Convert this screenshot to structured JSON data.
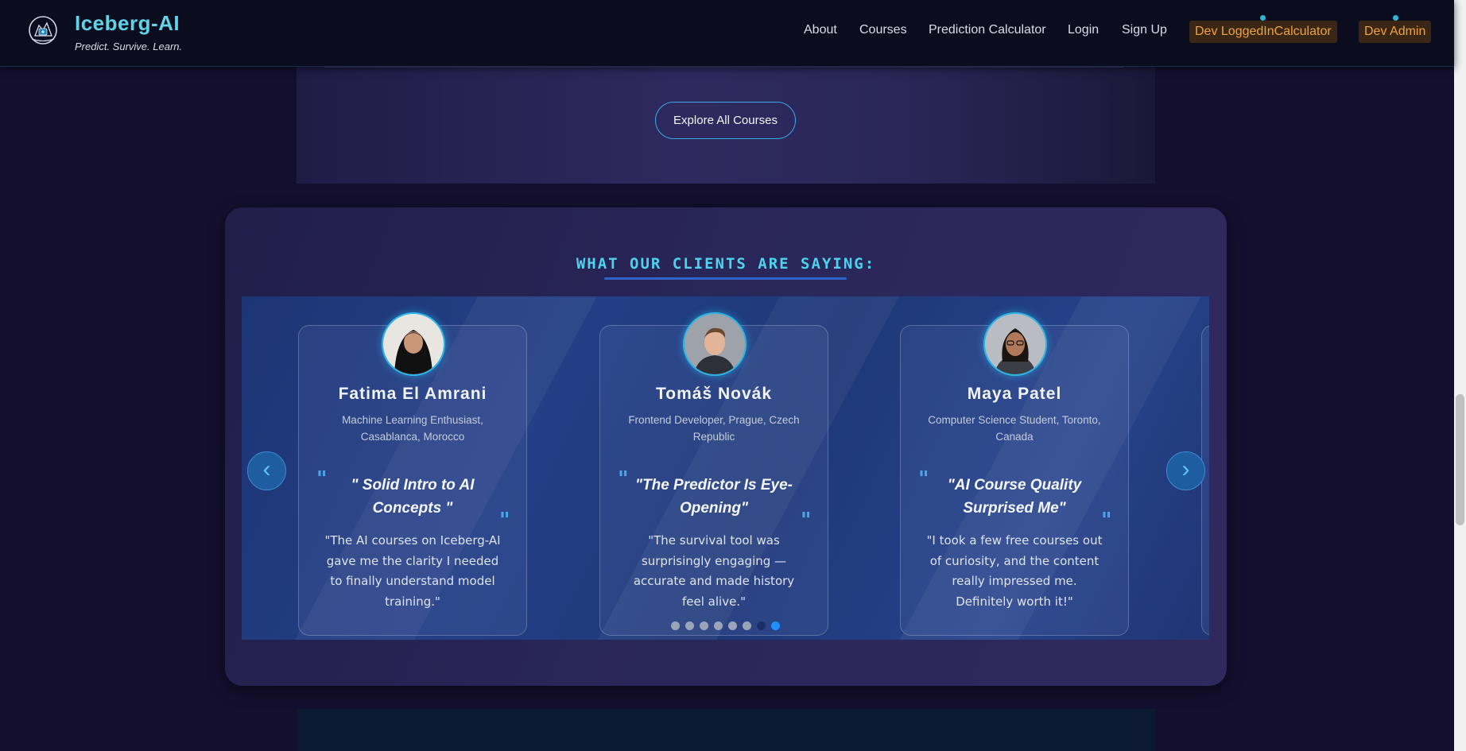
{
  "brand": {
    "title": "Iceberg-AI",
    "tagline": "Predict. Survive. Learn."
  },
  "nav": {
    "links": [
      "About",
      "Courses",
      "Prediction Calculator",
      "Login",
      "Sign Up"
    ],
    "dev_buttons": [
      "Dev LoggedInCalculator",
      "Dev Admin"
    ]
  },
  "courses": {
    "explore_label": "Explore All Courses"
  },
  "testimonials": {
    "title": "What our clients are saying:",
    "cards": [
      {
        "name": "Fatima El Amrani",
        "role": "Machine Learning Enthusiast, Casablanca, Morocco",
        "headline": "\" Solid Intro to AI Concepts \"",
        "text": "\"The AI courses on Iceberg-AI gave me the clarity I needed to finally understand model training.\""
      },
      {
        "name": "Tomáš Novák",
        "role": "Frontend Developer, Prague, Czech Republic",
        "headline": "\"The Predictor Is Eye-Opening\"",
        "text": "\"The survival tool was surprisingly engaging — accurate and made history feel alive.\""
      },
      {
        "name": "Maya Patel",
        "role": "Computer Science Student, Toronto, Canada",
        "headline": "\"AI Course Quality Surprised Me\"",
        "text": "\"I took a few free courses out of curiosity, and the content really impressed me. Definitely worth it!\""
      }
    ],
    "quote_glyph": "\"",
    "prev_arrow": "‹",
    "next_arrow": "›",
    "dot_count": 8,
    "active_dot": 8
  },
  "colors": {
    "accent": "#5fd4e8",
    "dev": "#f0a23c",
    "carousel": "#1f3574"
  },
  "icons": [
    "iceberg-logo-icon",
    "chevron-left-icon",
    "chevron-right-icon",
    "quote-icon"
  ]
}
